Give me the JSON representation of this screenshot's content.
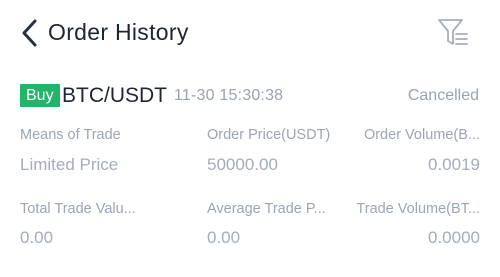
{
  "header": {
    "title": "Order History",
    "back_icon": "chevron-left-icon",
    "filter_icon": "filter-icon"
  },
  "order": {
    "side": "Buy",
    "pair": "BTC/USDT",
    "time": "11-30 15:30:38",
    "status": "Cancelled",
    "fields": {
      "means_of_trade": {
        "label": "Means of Trade",
        "value": "Limited Price"
      },
      "order_price": {
        "label": "Order Price(USDT)",
        "value": "50000.00"
      },
      "order_volume": {
        "label": "Order Volume(B...",
        "value": "0.0019"
      },
      "total_trade_value": {
        "label": "Total Trade Valu...",
        "value": "0.00"
      },
      "average_trade_price": {
        "label": "Average Trade P...",
        "value": "0.00"
      },
      "trade_volume": {
        "label": "Trade Volume(BT...",
        "value": "0.0000"
      }
    }
  },
  "colors": {
    "buy_badge": "#22b46b",
    "muted_text": "#9ca5b3",
    "primary_text": "#1f2633"
  }
}
